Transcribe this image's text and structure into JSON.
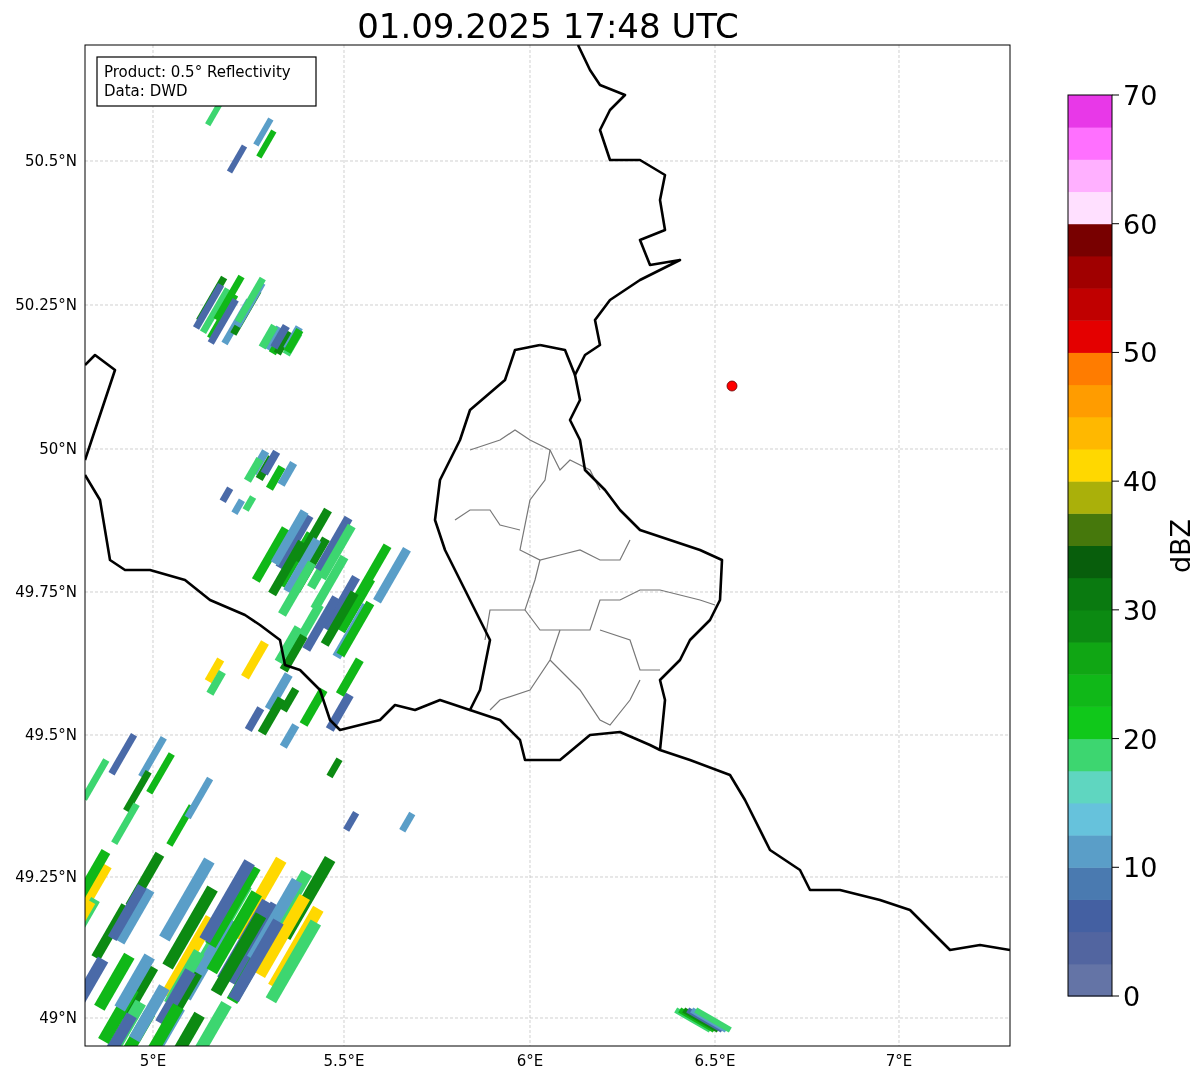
{
  "title": "01.09.2025 17:48 UTC",
  "info_box": [
    "Product: 0.5° Reflectivity",
    "Data: DWD"
  ],
  "x_ticks": [
    "5°E",
    "5.5°E",
    "6°E",
    "6.5°E",
    "7°E"
  ],
  "y_ticks": [
    "50.5°N",
    "50.25°N",
    "50°N",
    "49.75°N",
    "49.5°N",
    "49.25°N",
    "49°N"
  ],
  "colorbar": {
    "label": "dBZ",
    "ticks": [
      "70",
      "60",
      "50",
      "40",
      "30",
      "20",
      "10",
      "0"
    ],
    "segments": [
      {
        "color": "#6474a6"
      },
      {
        "color": "#5265a0"
      },
      {
        "color": "#4460a2"
      },
      {
        "color": "#4a7ab0"
      },
      {
        "color": "#5a9ec8"
      },
      {
        "color": "#66c2dc"
      },
      {
        "color": "#5fd6c0"
      },
      {
        "color": "#3dd670"
      },
      {
        "color": "#10c81a"
      },
      {
        "color": "#10b818"
      },
      {
        "color": "#10a614"
      },
      {
        "color": "#0c8a12"
      },
      {
        "color": "#0a7a10"
      },
      {
        "color": "#085e0c"
      },
      {
        "color": "#46780c"
      },
      {
        "color": "#aab00a"
      },
      {
        "color": "#ffd800"
      },
      {
        "color": "#ffb800"
      },
      {
        "color": "#ff9c00"
      },
      {
        "color": "#ff7c00"
      },
      {
        "color": "#e40000"
      },
      {
        "color": "#c00000"
      },
      {
        "color": "#a00000"
      },
      {
        "color": "#780000"
      },
      {
        "color": "#ffe0ff"
      },
      {
        "color": "#ffb0ff"
      },
      {
        "color": "#ff70ff"
      },
      {
        "color": "#e838e8"
      }
    ]
  }
}
